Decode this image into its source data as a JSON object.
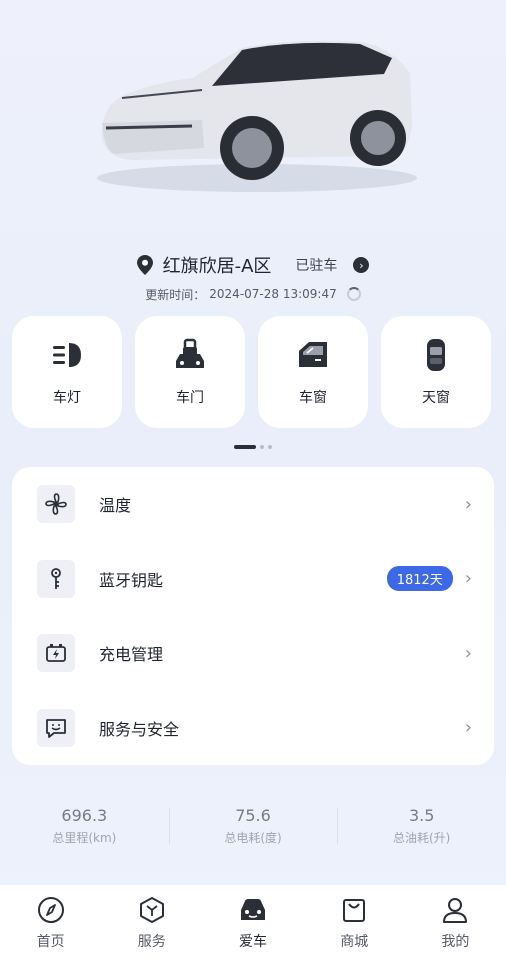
{
  "location": {
    "name": "红旗欣居-A区",
    "status": "已驻车"
  },
  "update": {
    "label": "更新时间：",
    "time": "2024-07-28 13:09:47"
  },
  "controls": [
    {
      "label": "车灯",
      "icon": "headlight-icon"
    },
    {
      "label": "车门",
      "icon": "car-door-lock-icon"
    },
    {
      "label": "车窗",
      "icon": "car-window-icon"
    },
    {
      "label": "天窗",
      "icon": "sunroof-icon"
    }
  ],
  "menu": [
    {
      "label": "温度",
      "icon": "fan-icon"
    },
    {
      "label": "蓝牙钥匙",
      "icon": "key-icon",
      "badge": "1812天"
    },
    {
      "label": "充电管理",
      "icon": "battery-charge-icon"
    },
    {
      "label": "服务与安全",
      "icon": "chat-service-icon"
    }
  ],
  "stats": [
    {
      "value": "696.3",
      "label": "总里程(km)"
    },
    {
      "value": "75.6",
      "label": "总电耗(度)"
    },
    {
      "value": "3.5",
      "label": "总油耗(升)"
    }
  ],
  "tabs": [
    {
      "label": "首页",
      "icon": "compass-icon"
    },
    {
      "label": "服务",
      "icon": "cube-icon"
    },
    {
      "label": "爱车",
      "icon": "car-icon",
      "active": true
    },
    {
      "label": "商城",
      "icon": "shopping-bag-icon"
    },
    {
      "label": "我的",
      "icon": "user-icon"
    }
  ],
  "colors": {
    "accent": "#3d68e6",
    "dark": "#2b2f38"
  }
}
